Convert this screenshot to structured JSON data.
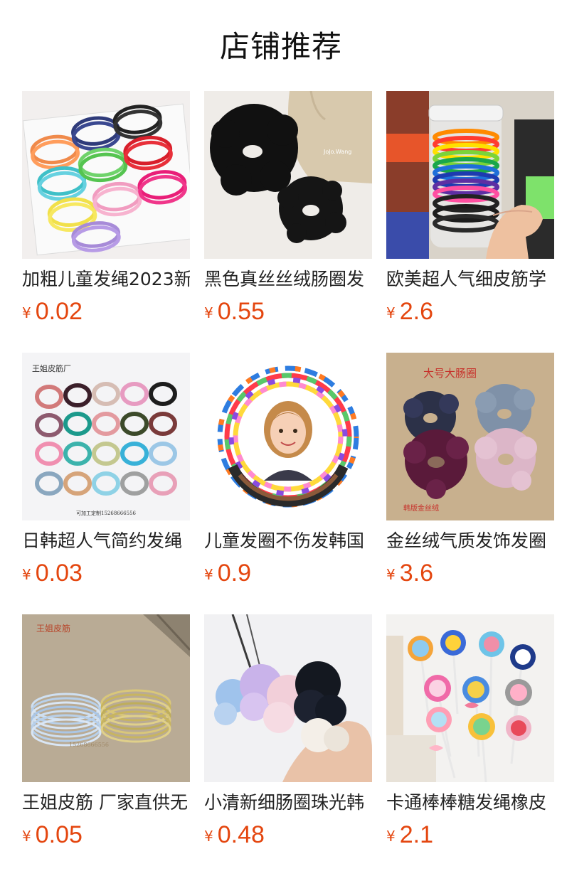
{
  "header": {
    "title": "店铺推荐"
  },
  "currency_symbol": "¥",
  "colors": {
    "price": "#e4460f",
    "title": "#111111"
  },
  "products": [
    {
      "name": "加粗儿童发绳2023新",
      "price": "0.02",
      "image": "box-of-colorful-hair-ties"
    },
    {
      "name": "黑色真丝丝绒肠圈发",
      "price": "0.55",
      "image": "black-velvet-scrunchies"
    },
    {
      "name": "欧美超人气细皮筋学",
      "price": "2.6",
      "image": "jar-of-rainbow-hair-ties"
    },
    {
      "name": "日韩超人气简约发绳",
      "price": "0.03",
      "image": "grid-of-hair-tie-bundles",
      "image_text": [
        "王姐皮筋厂",
        "可加工定制15268666556"
      ]
    },
    {
      "name": "儿童发圈不伤发韩国",
      "price": "0.9",
      "image": "girl-in-ring-of-hair-ties"
    },
    {
      "name": "金丝绒气质发饰发圈",
      "price": "3.6",
      "image": "velvet-scrunchies-on-board",
      "image_text": [
        "大号大肠圈",
        "韩版金丝绒"
      ]
    },
    {
      "name": "王姐皮筋 厂家直供无",
      "price": "0.05",
      "image": "glitter-hair-ties",
      "image_text": [
        "王姐皮筋",
        "15268666556"
      ]
    },
    {
      "name": "小清新细肠圈珠光韩",
      "price": "0.48",
      "image": "satin-scrunchies-on-hand"
    },
    {
      "name": "卡通棒棒糖发绳橡皮",
      "price": "2.1",
      "image": "lollipop-hair-tie-packs"
    }
  ]
}
